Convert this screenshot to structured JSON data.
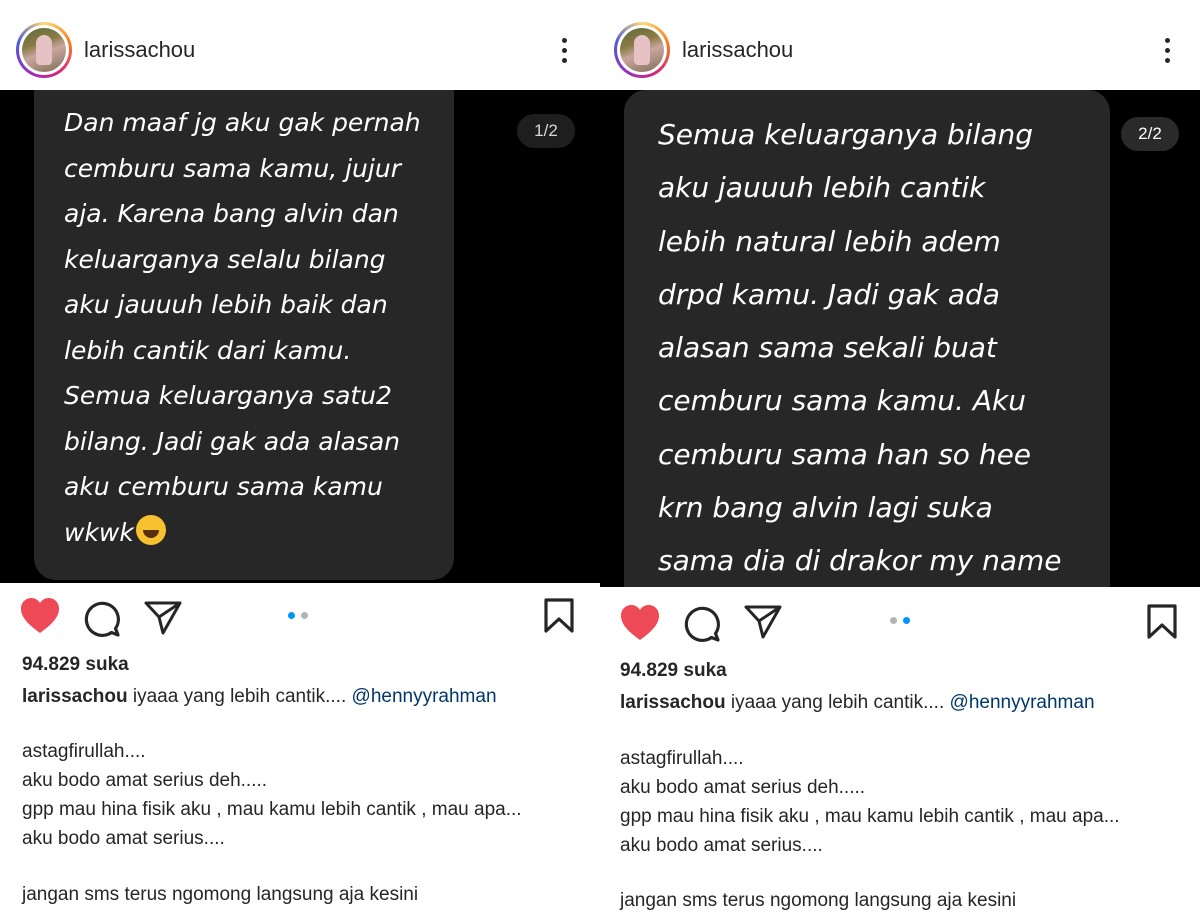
{
  "posts": [
    {
      "username": "larissachou",
      "counter": "1/2",
      "message": "Dan maaf jg aku gak pernah\ncemburu sama kamu, jujur\naja. Karena bang alvin dan\nkeluarganya selalu bilang\naku jauuuh lebih baik dan\nlebih cantik dari kamu.\nSemua keluarganya satu2\nbilang. Jadi gak ada alasan\naku cemburu sama kamu\nwkwk",
      "message_emoji": "😅",
      "likes": "94.829 suka",
      "caption_username": "larissachou",
      "caption_text": "iyaaa yang lebih cantik....",
      "caption_mention": "@hennyyrahman",
      "body_lines": [
        "astagfirullah....",
        "aku bodo amat serius deh.....",
        "gpp mau hina fisik aku , mau kamu lebih cantik , mau apa...",
        "aku bodo amat serius....",
        "",
        "jangan sms terus ngomong langsung aja kesini"
      ],
      "active_dot": 0
    },
    {
      "username": "larissachou",
      "counter": "2/2",
      "message": "Semua keluarganya bilang\naku jauuuh lebih cantik\nlebih natural lebih adem\ndrpd kamu. Jadi gak ada\nalasan sama sekali buat\ncemburu sama kamu. Aku\ncemburu sama han so hee\nkrn bang alvin lagi suka\nsama dia di drakor my name",
      "message_emoji": "",
      "likes": "94.829 suka",
      "caption_username": "larissachou",
      "caption_text": "iyaaa yang lebih cantik....",
      "caption_mention": "@hennyyrahman",
      "body_lines": [
        "astagfirullah....",
        "aku bodo amat serius deh.....",
        "gpp mau hina fisik aku , mau kamu lebih cantik , mau apa...",
        "aku bodo amat serius....",
        "",
        "jangan sms terus ngomong langsung aja kesini"
      ],
      "active_dot": 1
    }
  ],
  "icons": {
    "like": "heart-icon",
    "comment": "comment-icon",
    "share": "paper-plane-icon",
    "save": "bookmark-icon",
    "more": "more-options-icon"
  },
  "colors": {
    "like_red": "#ed4956",
    "active_dot": "#0095f6",
    "mention": "#00376b",
    "text": "#262626"
  }
}
